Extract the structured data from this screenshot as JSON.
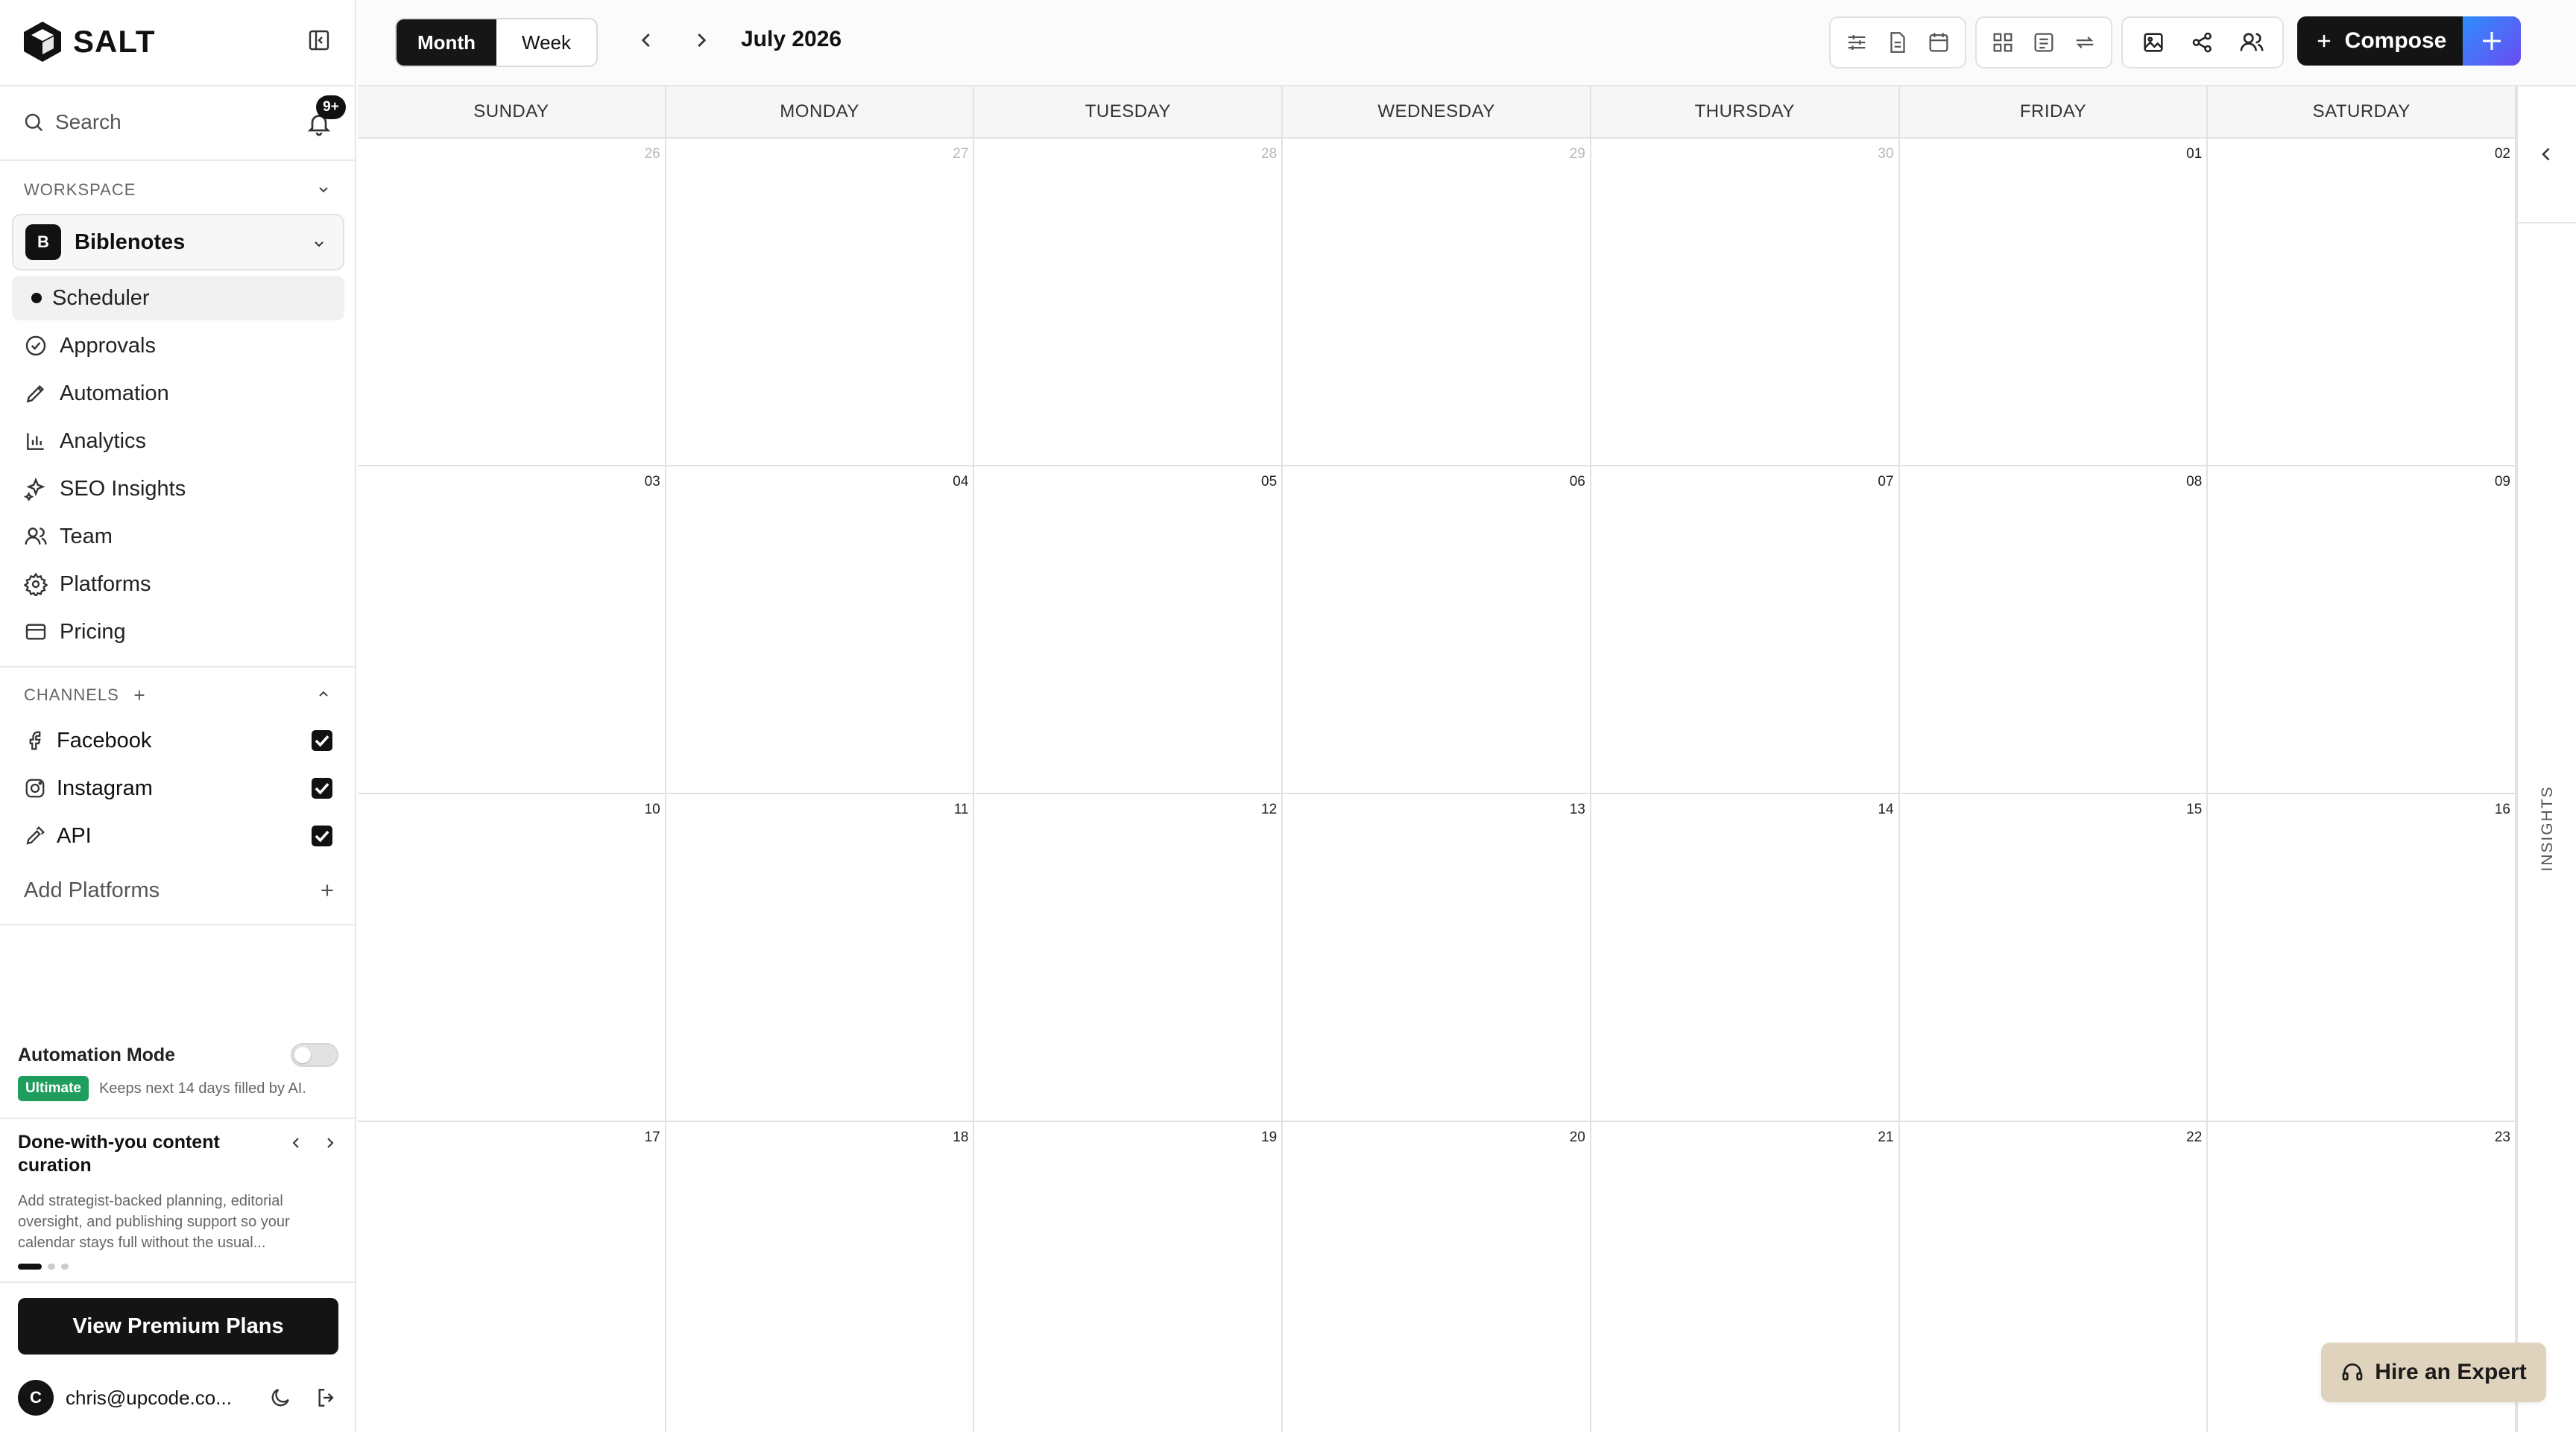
{
  "brand": {
    "name": "SALT"
  },
  "sidebar": {
    "search_label": "Search",
    "notification_badge": "9+",
    "workspace_label": "WORKSPACE",
    "workspace": {
      "initial": "B",
      "name": "Biblenotes"
    },
    "nav": [
      {
        "label": "Scheduler",
        "icon": "dot"
      },
      {
        "label": "Approvals",
        "icon": "check-circle-icon"
      },
      {
        "label": "Automation",
        "icon": "pen-icon"
      },
      {
        "label": "Analytics",
        "icon": "bar-chart-icon"
      },
      {
        "label": "SEO Insights",
        "icon": "sparkles-icon"
      },
      {
        "label": "Team",
        "icon": "users-icon"
      },
      {
        "label": "Platforms",
        "icon": "gear-icon"
      },
      {
        "label": "Pricing",
        "icon": "credit-card-icon"
      }
    ],
    "channels_label": "CHANNELS",
    "channels": [
      {
        "label": "Facebook",
        "icon": "facebook-icon",
        "checked": true
      },
      {
        "label": "Instagram",
        "icon": "instagram-icon",
        "checked": true
      },
      {
        "label": "API",
        "icon": "key-icon",
        "checked": true
      }
    ],
    "add_platforms_label": "Add Platforms",
    "automation_mode_label": "Automation Mode",
    "ultimate_badge": "Ultimate",
    "ultimate_desc": "Keeps next 14 days filled by AI.",
    "promo": {
      "title": "Done-with-you content curation",
      "body_line1": "Add strategist-backed planning, editorial",
      "body_line2": "oversight, and publishing support so your",
      "body_line3": "calendar stays full without the usual..."
    },
    "premium_button": "View Premium Plans",
    "user_email": "chris@upcode.co...",
    "user_initial": "C"
  },
  "toolbar": {
    "month_tab": "Month",
    "week_tab": "Week",
    "current_period": "July 2026",
    "compose_label": "Compose"
  },
  "calendar": {
    "weekdays": [
      "SUNDAY",
      "MONDAY",
      "TUESDAY",
      "WEDNESDAY",
      "THURSDAY",
      "FRIDAY",
      "SATURDAY"
    ],
    "weeks": [
      [
        "26",
        "27",
        "28",
        "29",
        "30",
        "01",
        "02"
      ],
      [
        "03",
        "04",
        "05",
        "06",
        "07",
        "08",
        "09"
      ],
      [
        "10",
        "11",
        "12",
        "13",
        "14",
        "15",
        "16"
      ],
      [
        "17",
        "18",
        "19",
        "20",
        "21",
        "22",
        "23"
      ]
    ],
    "out_of_month": [
      "26",
      "27",
      "28",
      "29",
      "30"
    ]
  },
  "insights_label": "INSIGHTS",
  "hire_button": "Hire an Expert",
  "colors": {
    "accent_dark": "#141414",
    "ultimate_green": "#1f9d5c",
    "hire_bg": "#e0d3bd",
    "compose_gradient_start": "#2f8dff",
    "compose_gradient_end": "#6a4cf0"
  }
}
